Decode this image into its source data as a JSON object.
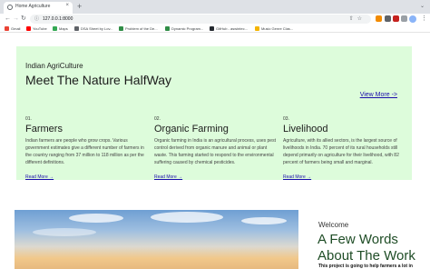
{
  "browser": {
    "tab_title": "Home Agriculture",
    "tab_close": "×",
    "new_tab": "+",
    "tabstrip_menu": "⌄",
    "back": "←",
    "forward": "→",
    "reload": "↻",
    "lock": "ⓘ",
    "url": "127.0.0.1:8000",
    "omnibox_icons": "⇧☆",
    "menu": "⋮"
  },
  "bookmarks": [
    {
      "label": "Gmail",
      "color": "#ea4335"
    },
    {
      "label": "YouTube",
      "color": "#ff0000"
    },
    {
      "label": "Maps",
      "color": "#34a853"
    },
    {
      "label": "DSA Sheet by Lov...",
      "color": "#5f6368"
    },
    {
      "label": "Problem of the De...",
      "color": "#2f8d46"
    },
    {
      "label": "Dynamic Program...",
      "color": "#2f8d46"
    },
    {
      "label": "GitHub - aswintec...",
      "color": "#24292f"
    },
    {
      "label": "Music Genre Clas...",
      "color": "#f4b400"
    }
  ],
  "hero": {
    "brand": "Indian AgriCulture",
    "headline": "Meet The Nature HalfWay",
    "view_more": "View More ->",
    "background": "#ddfcdb"
  },
  "features": [
    {
      "num": "01.",
      "title": "Farmers",
      "text": "Indian farmers are people who grow crops. Various government estimates give a different number of farmers in the country ranging from 37 million to 118 million as per the different definitions.",
      "link": "Read More →"
    },
    {
      "num": "02.",
      "title": "Organic Farming",
      "text": "Organic farming in India is an agricultural process, uses pest control derived from organic manure and animal or plant waste. This farming started to respond to the environmental suffering caused by chemical pesticides.",
      "link": "Read More →"
    },
    {
      "num": "03.",
      "title": "Livelihood",
      "text": "Agriculture, with its allied sectors, is the largest source of livelihoods in India. 70 percent of its rural households still depend primarily on agriculture for their livelihood, with 82 percent of farmers being small and marginal.",
      "link": "Read More →"
    }
  ],
  "about": {
    "welcome": "Welcome",
    "heading": "A Few Words About The Work",
    "intro": "This project is going to help farmers a lot in"
  }
}
